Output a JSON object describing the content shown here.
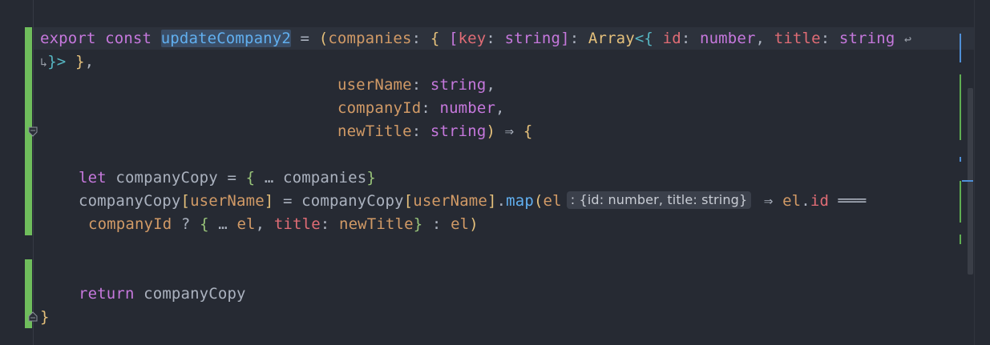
{
  "editor": {
    "line1": {
      "export": "export",
      "const": "const",
      "name": "updateCompany2",
      "eq": " = ",
      "open_paren": "(",
      "companies": "companies",
      "colon1": ": ",
      "brace_open": "{",
      "bracket_open": " [",
      "key": "key",
      "colon2": ": ",
      "string1": "string",
      "bracket_close": "]",
      "colon3": ": ",
      "array": "Array",
      "lt": "<{ ",
      "id": "id",
      "colon4": ": ",
      "number1": "number",
      "comma1": ", ",
      "title": "title",
      "colon5": ": ",
      "string2": "string",
      "wrap_icon": "↩"
    },
    "line2": {
      "wrap_icon": "↳",
      "close_inner": "}>",
      "close_outer": " }",
      "comma": ","
    },
    "line3": {
      "param": "userName",
      "colon": ": ",
      "type": "string",
      "comma": ","
    },
    "line4": {
      "param": "companyId",
      "colon": ": ",
      "type": "number",
      "comma": ","
    },
    "line5": {
      "param": "newTitle",
      "colon": ": ",
      "type": "string",
      "close": ")",
      "arrow": " ⇒ ",
      "brace": "{"
    },
    "line6": {
      "let": "let",
      "name": "companyCopy",
      "eq": " = ",
      "brace_open": "{",
      "spread": " … ",
      "companies": "companies",
      "brace_close": "}"
    },
    "line7": {
      "lhs": "companyCopy",
      "b1": "[",
      "key1": "userName",
      "b2": "]",
      "eq": " = ",
      "rhs": "companyCopy",
      "b3": "[",
      "key2": "userName",
      "b4": "]",
      "dot": ".",
      "map": "map",
      "paren": "(",
      "el": "el",
      "hint": ": {id: number, title: string}",
      "arrow": " ⇒ ",
      "el2": "el",
      "dot2": ".",
      "idprop": "id",
      "eqeq": " ═══"
    },
    "line8": {
      "companyId": "companyId",
      "q": " ? ",
      "brace_open": "{",
      "spread": " … ",
      "el": "el",
      "comma": ", ",
      "title": "title",
      "colon": ": ",
      "newTitle": "newTitle",
      "brace_close": "}",
      "colon2": " : ",
      "el2": "el",
      "close": ")"
    },
    "line9": {
      "return": "return",
      "name": "companyCopy"
    },
    "line10": {
      "brace": "}"
    }
  }
}
